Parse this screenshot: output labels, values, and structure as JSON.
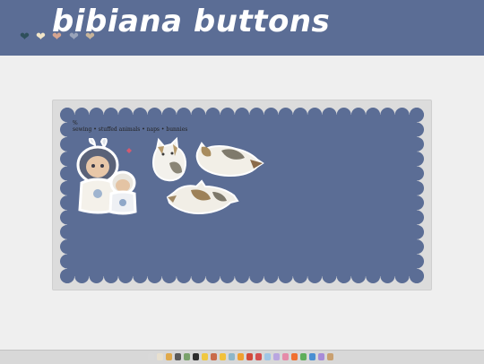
{
  "header": {
    "site_title": "bibiana buttons",
    "hearts": [
      {
        "icon": "heart-icon",
        "color": "#2e4f5b"
      },
      {
        "icon": "heart-icon",
        "color": "#f2e6c8"
      },
      {
        "icon": "heart-icon",
        "color": "#d5a48f"
      },
      {
        "icon": "heart-icon",
        "color": "#9aa4ba"
      },
      {
        "icon": "heart-icon",
        "color": "#c8b49a"
      }
    ]
  },
  "panel": {
    "pronouns": "%",
    "interests": "sewing • stuffed animals • naps • bunnies",
    "images": [
      "stickers-image",
      "cat-image",
      "cat-image",
      "cat-image"
    ]
  },
  "colors": {
    "header_bg": "#5b6d95",
    "scallop_bg": "#5b6d95",
    "page_bg": "#efefef"
  },
  "taskbar": {
    "icons": [
      "rabbit-icon",
      "cup-icon",
      "bread-icon",
      "paw-icon",
      "house-icon",
      "eye-icon",
      "sparkle-icon",
      "doll-icon",
      "sun-icon",
      "alien-icon",
      "orange-icon",
      "apple-icon",
      "strawberry-icon",
      "cloud-icon",
      "music-icon",
      "flower-icon",
      "fire-icon",
      "leaf-icon",
      "butterfly-icon",
      "feather-icon",
      "envelope-icon"
    ]
  }
}
